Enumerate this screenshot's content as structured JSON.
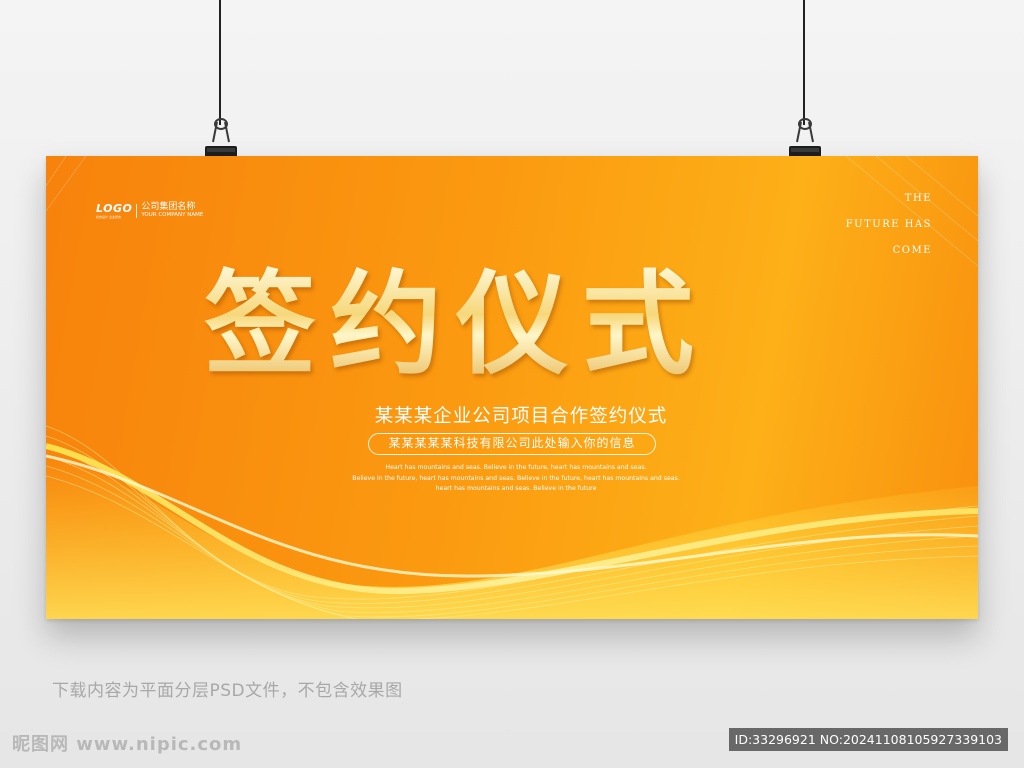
{
  "banner": {
    "logo_mark": "LOGO",
    "logo_sub": "标志设计 企业标志",
    "company_name": "公司集团名称",
    "company_name_en": "YOUR COMPANY NAME",
    "future_lines": [
      "THE",
      "FUTURE HAS",
      "COME"
    ],
    "title": "签约仪式",
    "subtitle": "某某某企业公司项目合作签约仪式",
    "pill_text": "某某某某某科技有限公司此处输入你的信息",
    "small_lines": [
      "Heart has mountains and seas. Believe in the future, heart has mountains and seas.",
      "Believe in the future, heart has mountains and seas. Believe in the future, heart has mountains and seas.",
      "heart has mountains and seas. Believe in the future"
    ]
  },
  "caption": "下载内容为平面分层PSD文件，不包含效果图",
  "watermark": {
    "site": "昵图网 www.nipic.com",
    "id_text": "ID:33296921 NO:20241108105927339103"
  },
  "colors": {
    "banner_orange": "#f7820c",
    "banner_light": "#fdb018",
    "gold": "#f6d77a",
    "background": "#efefef"
  },
  "icons": [
    "binder-clip-icon",
    "binder-clip-icon"
  ]
}
